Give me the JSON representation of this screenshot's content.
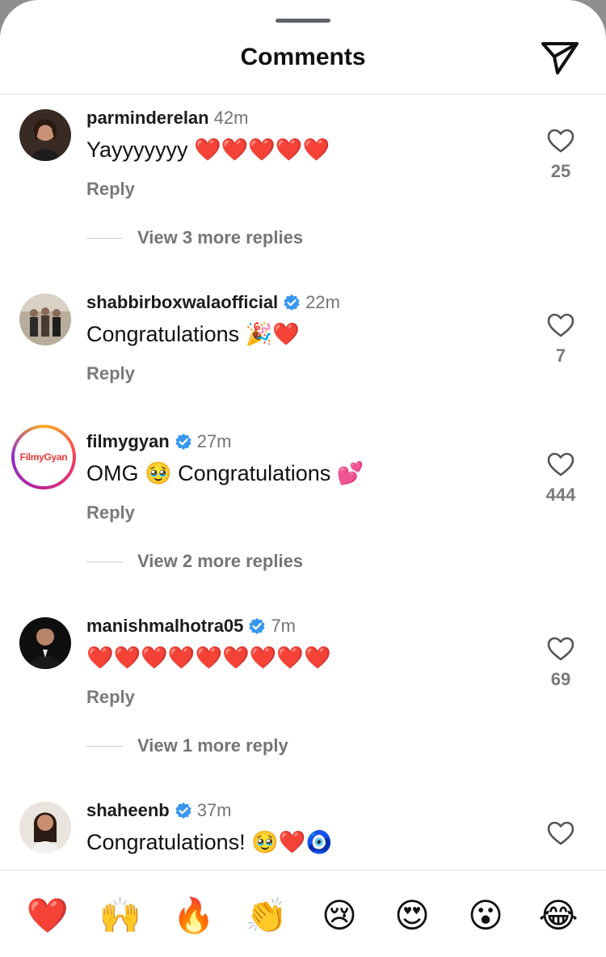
{
  "header": {
    "title": "Comments",
    "share_icon": "paper-plane-icon"
  },
  "comments": [
    {
      "username": "parminderelan",
      "verified": false,
      "time": "42m",
      "text": "Yayyyyyyy ❤️❤️❤️❤️❤️",
      "reply": "Reply",
      "likes": "25",
      "more_replies": "View 3 more replies"
    },
    {
      "username": "shabbirboxwalaofficial",
      "verified": true,
      "time": "22m",
      "text": "Congratulations 🎉❤️",
      "reply": "Reply",
      "likes": "7",
      "more_replies": ""
    },
    {
      "username": "filmygyan",
      "verified": true,
      "time": "27m",
      "text": "OMG 🥹 Congratulations 💕",
      "reply": "Reply",
      "likes": "444",
      "more_replies": "View 2 more replies",
      "avatar_text_a": "Filmy",
      "avatar_text_b": "Gyan"
    },
    {
      "username": "manishmalhotra05",
      "verified": true,
      "time": "7m",
      "text": "❤️❤️❤️❤️❤️❤️❤️❤️❤️",
      "reply": "Reply",
      "likes": "69",
      "more_replies": "View 1 more reply"
    },
    {
      "username": "shaheenb",
      "verified": true,
      "time": "37m",
      "text": "Congratulations! 🥹❤️🧿",
      "reply": "",
      "likes": ""
    }
  ],
  "reactions": [
    "❤️",
    "🙌",
    "🔥",
    "👏",
    "😢",
    "😍",
    "😮",
    "😂"
  ],
  "colors": {
    "verified_blue": "#3897f0",
    "muted_text": "#7a7a7a",
    "heart_red": "#e0141e"
  }
}
